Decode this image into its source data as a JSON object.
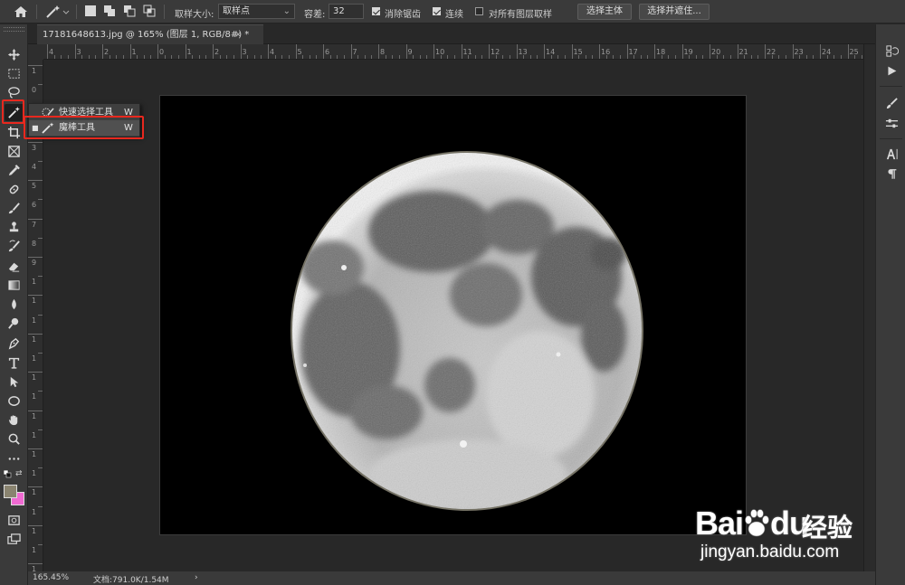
{
  "options_bar": {
    "sample_size_label": "取样大小:",
    "sample_size_value": "取样点",
    "tolerance_label": "容差:",
    "tolerance_value": "32",
    "anti_alias_label": "消除锯齿",
    "anti_alias_checked": true,
    "contiguous_label": "连续",
    "contiguous_checked": true,
    "sample_all_layers_label": "对所有图层取样",
    "sample_all_layers_checked": false,
    "select_subject_label": "选择主体",
    "select_and_mask_label": "选择并遮住..."
  },
  "document_tab": {
    "title": "17181648613.jpg @ 165% (图层 1, RGB/8#) *",
    "close_glyph": "×"
  },
  "tool_flyout": {
    "items": [
      {
        "label": "快速选择工具",
        "shortcut": "W",
        "selected": false
      },
      {
        "label": "魔棒工具",
        "shortcut": "W",
        "selected": true
      }
    ]
  },
  "ruler_h_labels": [
    "4",
    "3",
    "2",
    "1",
    "0",
    "1",
    "2",
    "3",
    "4",
    "5",
    "6",
    "7",
    "8",
    "9",
    "10",
    "11",
    "12",
    "13",
    "14",
    "15",
    "16",
    "17",
    "18",
    "19",
    "20",
    "21",
    "22",
    "23",
    "24",
    "25"
  ],
  "ruler_v_labels": [
    "1",
    "0",
    "1",
    "2",
    "3",
    "4",
    "5",
    "6",
    "7",
    "8",
    "9",
    "1",
    "1",
    "1",
    "1",
    "1",
    "1",
    "1",
    "1",
    "1",
    "1",
    "1",
    "1",
    "1",
    "1",
    "1",
    "1"
  ],
  "status_bar": {
    "zoom": "165.45%",
    "doc_info": "文档:791.0K/1.54M",
    "arrow": "›"
  },
  "colors": {
    "foreground": "#8a8470",
    "background": "#f06ad2",
    "highlight": "#e8281e"
  },
  "watermark": {
    "brand": "Bai",
    "brand_tail": "du",
    "cn": "经验",
    "url": "jingyan.baidu.com"
  }
}
